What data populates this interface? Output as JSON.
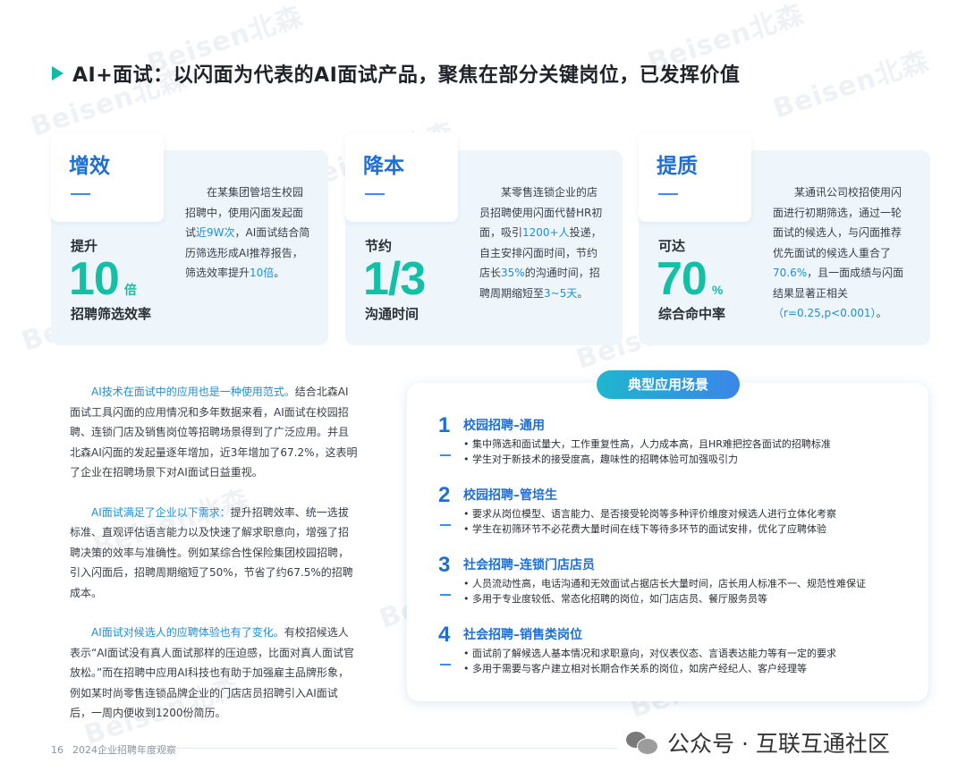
{
  "watermark": "Beisen北森",
  "title": "AI+面试：以闪面为代表的AI面试产品，聚焦在部分关键岗位，已发挥价值",
  "cards": [
    {
      "tag": "增效",
      "pre": "提升",
      "big": "10",
      "unit": "倍",
      "post": "招聘筛选效率",
      "desc": [
        {
          "t": "在某集团管培生校园招聘中，使用闪面发起面试",
          "hl": false
        },
        {
          "t": "近9W次",
          "hl": true
        },
        {
          "t": "，AI面试结合简历筛选形成AI推荐报告，筛选效率提升",
          "hl": false
        },
        {
          "t": "10倍",
          "hl": true
        },
        {
          "t": "。",
          "hl": false
        }
      ]
    },
    {
      "tag": "降本",
      "pre": "节约",
      "big": "1/3",
      "unit": "",
      "post": "沟通时间",
      "desc": [
        {
          "t": "某零售连锁企业的店员招聘使用闪面代替HR初面，吸引",
          "hl": false
        },
        {
          "t": "1200+人",
          "hl": true
        },
        {
          "t": "投递，自主安排闪面时间，节约店长",
          "hl": false
        },
        {
          "t": "35%",
          "hl": true
        },
        {
          "t": "的沟通时间，招聘周期缩短至",
          "hl": false
        },
        {
          "t": "3~5天",
          "hl": true
        },
        {
          "t": "。",
          "hl": false
        }
      ]
    },
    {
      "tag": "提质",
      "pre": "可达",
      "big": "70",
      "unit": "%",
      "post": "综合命中率",
      "desc": [
        {
          "t": "某通讯公司校招使用闪面进行初期筛选，通过一轮面试的候选人，与闪面推荐优先面试的候选人重合了",
          "hl": false
        },
        {
          "t": "70.6%",
          "hl": true
        },
        {
          "t": "，且一面成绩与闪面结果显著正相关",
          "hl": false
        },
        {
          "t": "（r=0.25,p<0.001）",
          "hl": true
        },
        {
          "t": "。",
          "hl": false
        }
      ]
    }
  ],
  "paragraphs": [
    {
      "lead": "AI技术在面试中的应用也是一种使用范式。",
      "body": "结合北森AI面试工具闪面的应用情况和多年数据来看，AI面试在校园招聘、连锁门店及销售岗位等招聘场景得到了广泛应用。并且北森AI闪面的发起量逐年增加，近3年增加了67.2%，这表明了企业在招聘场景下对AI面试日益重视。"
    },
    {
      "lead": "AI面试满足了企业以下需求：",
      "body": "提升招聘效率、统一选拔标准、直观评估语言能力以及快速了解求职意向，增强了招聘决策的效率与准确性。例如某综合性保险集团校园招聘，引入闪面后，招聘周期缩短了50%，节省了约67.5%的招聘成本。"
    },
    {
      "lead": "AI面试对候选人的应聘体验也有了变化。",
      "body": "有校招候选人表示“AI面试没有真人面试那样的压迫感，比面对真人面试官放松。”而在招聘中应用AI科技也有助于加强雇主品牌形象，例如某时尚零售连锁品牌企业的门店店员招聘引入AI面试后，一周内便收到1200份简历。"
    }
  ],
  "panel": {
    "header": "典型应用场景",
    "items": [
      {
        "num": "1",
        "title": "校园招聘–通用",
        "bullets": [
          "集中筛选和面试量大，工作重复性高，人力成本高，且HR难把控各面试的招聘标准",
          "学生对于新技术的接受度高，趣味性的招聘体验可加强吸引力"
        ]
      },
      {
        "num": "2",
        "title": "校园招聘–管培生",
        "bullets": [
          "要求从岗位模型、语言能力、是否接受轮岗等多种评价维度对候选人进行立体化考察",
          "学生在初筛环节不必花费大量时间在线下等待多环节的面试安排，优化了应聘体验"
        ]
      },
      {
        "num": "3",
        "title": "社会招聘–连锁门店店员",
        "bullets": [
          "人员流动性高，电话沟通和无效面试占据店长大量时间，店长用人标准不一、规范性难保证",
          "多用于专业度较低、常态化招聘的岗位，如门店店员、餐厅服务员等"
        ]
      },
      {
        "num": "4",
        "title": "社会招聘–销售类岗位",
        "bullets": [
          "面试前了解候选人基本情况和求职意向，对仪表仪态、言语表达能力等有一定的要求",
          "多用于需要与客户建立相对长期合作关系的岗位，如房产经纪人、客户经理等"
        ]
      }
    ]
  },
  "footer": {
    "page": "16",
    "report": "2024企业招聘年度观察"
  },
  "wechat": "公众号 · 互联互通社区"
}
